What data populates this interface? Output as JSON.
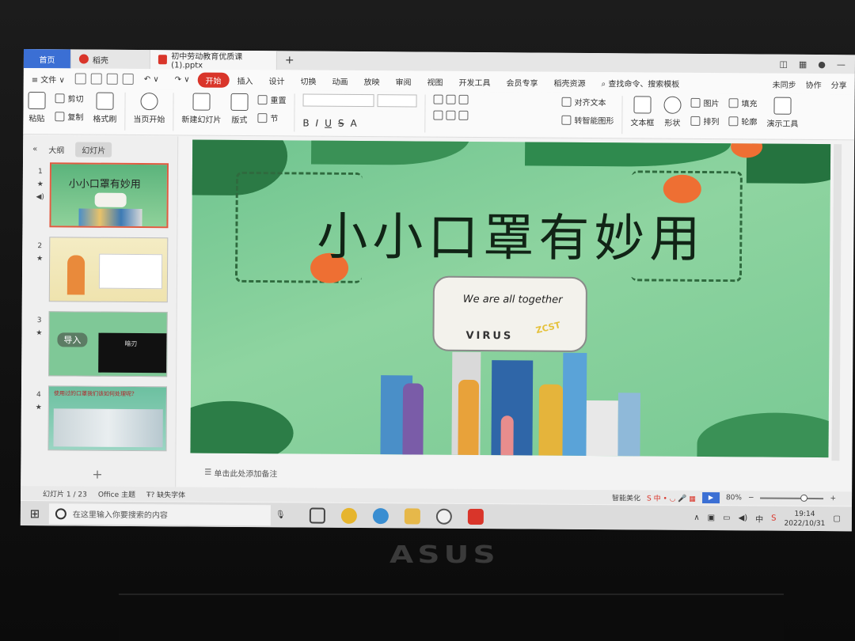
{
  "tabs": {
    "home": "首页",
    "wps": "稻壳",
    "doc": "初中劳动教育优质课(1).pptx",
    "plus": "+"
  },
  "menu": {
    "file": "≡ 文件 ∨",
    "items": [
      "开始",
      "插入",
      "设计",
      "切换",
      "动画",
      "放映",
      "审阅",
      "视图",
      "开发工具",
      "会员专享",
      "稻壳资源"
    ],
    "search": "查找命令、搜索模板",
    "right": [
      "未同步",
      "协作",
      "分享"
    ]
  },
  "ribbon": {
    "paste": "粘贴",
    "cut": "剪切",
    "copy": "复制",
    "format_painter": "格式刷",
    "from_current": "当页开始",
    "new_slide": "新建幻灯片",
    "layout": "版式",
    "reset": "重置",
    "section": "节",
    "align_text": "对齐文本",
    "smartart": "转智能图形",
    "textbox": "文本框",
    "shape": "形状",
    "picture": "图片",
    "arrange": "排列",
    "fill": "填充",
    "outline": "轮廓",
    "present_tool": "演示工具"
  },
  "leftpane": {
    "outline_tab": "大纲",
    "slides_tab": "幻灯片",
    "slide_numbers": [
      "1",
      "2",
      "3",
      "4"
    ],
    "thumb1_title": "小小口罩有妙用",
    "thumb3_label": "导入",
    "thumb3_video": "暗刃",
    "thumb4_text": "使用过的口罩我们该如何处理呢？"
  },
  "slide": {
    "title": "小小口罩有妙用",
    "mask_line1": "We are all together",
    "mask_line2": "VIRUS",
    "mask_line3": "ZCST"
  },
  "notes": {
    "placeholder": "单击此处添加备注"
  },
  "status": {
    "slide_index": "幻灯片 1 / 23",
    "theme": "Office 主题",
    "missing_font": "缺失字体",
    "beautify": "智能美化",
    "zoom": "80%"
  },
  "taskbar": {
    "search_placeholder": "在这里输入你要搜索的内容",
    "ime": "中",
    "time": "19:14",
    "date": "2022/10/31"
  },
  "brand": {
    "logo": "ASUS"
  },
  "colors": {
    "accent": "#d9352a",
    "home_tab": "#3b6fd4",
    "slide_green": "#79c994"
  }
}
